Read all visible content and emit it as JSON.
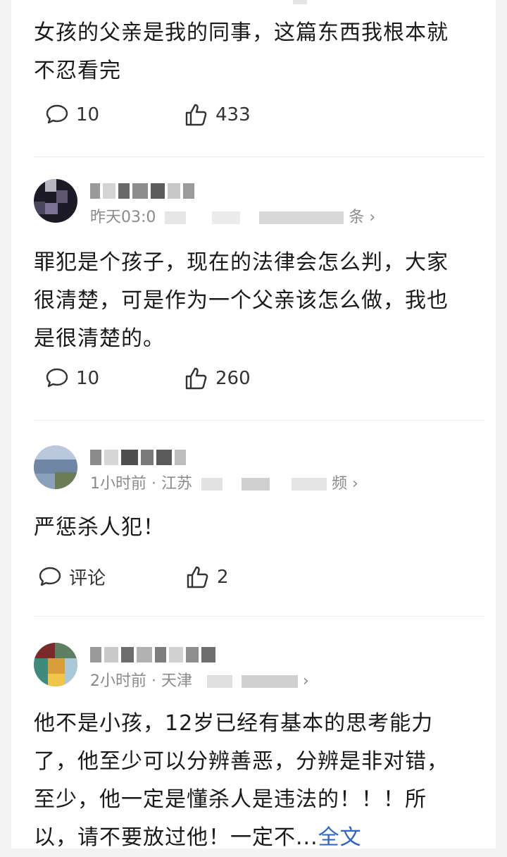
{
  "comments": [
    {
      "text_lines": [
        "女孩的父亲是我的同事，这篇东西我根本就",
        "不忍看完"
      ],
      "reply_count": "10",
      "like_count": "433"
    },
    {
      "meta_time": "昨天03:0",
      "meta_suffix": "条",
      "text_lines": [
        "罪犯是个孩子，现在的法律会怎么判，大家",
        "很清楚，可是作为一个父亲该怎么做，我也",
        "是很清楚的。"
      ],
      "reply_count": "10",
      "like_count": "260"
    },
    {
      "meta_time": "1小时前 · 江苏",
      "meta_suffix": "频",
      "text_lines": [
        "严惩杀人犯！"
      ],
      "reply_label": "评论",
      "like_count": "2"
    },
    {
      "meta_time": "2小时前 · 天津",
      "text_lines": [
        "他不是小孩，12岁已经有基本的思考能力",
        "了，他至少可以分辨善恶，分辨是非对错，",
        "至少，他一定是懂杀人是违法的！！！所",
        "以，请不要放过他！一定不..."
      ],
      "full_text_label": "全文"
    }
  ],
  "icons": {
    "reply": "speech-bubble-icon",
    "like": "thumbs-up-icon",
    "chevron": "chevron-right-icon"
  },
  "colors": {
    "link": "#2b63c9",
    "meta": "#8a8a8a",
    "text": "#1a1a1a"
  }
}
